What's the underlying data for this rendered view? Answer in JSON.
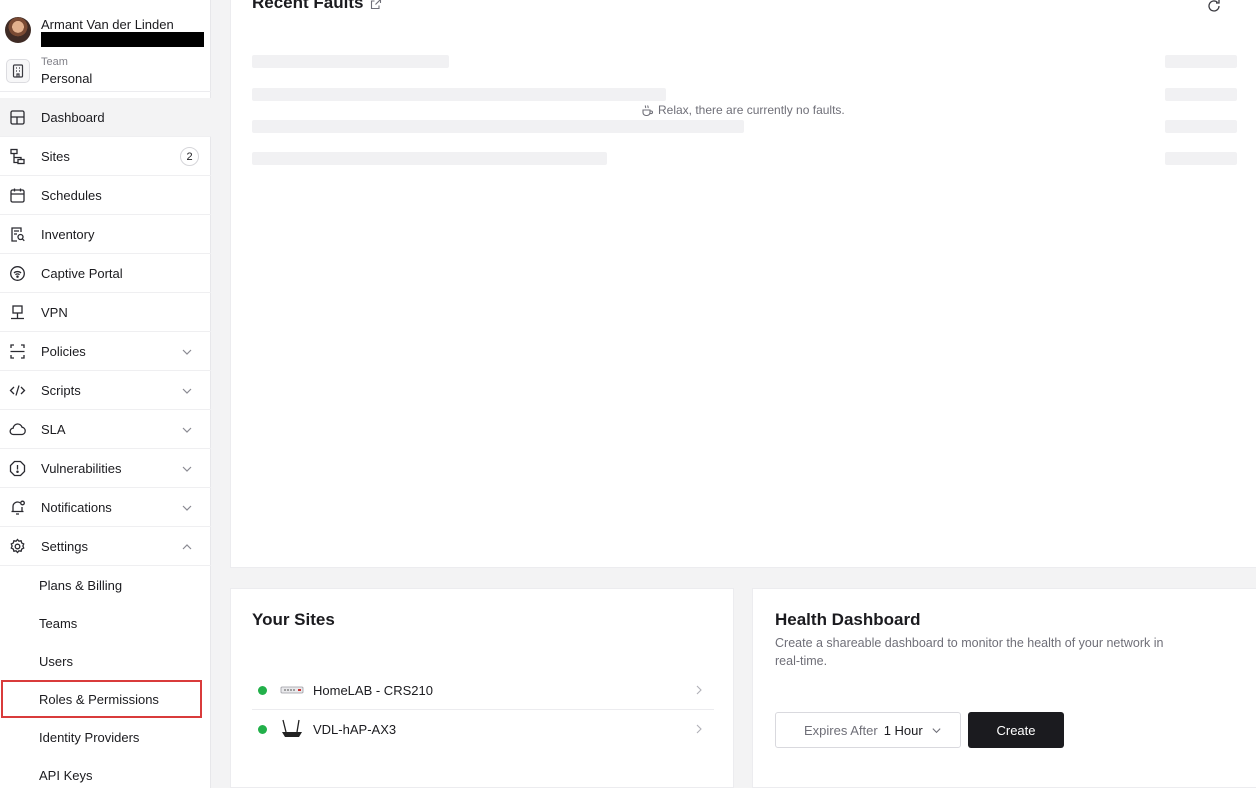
{
  "user": {
    "name": "Armant Van der Linden"
  },
  "team": {
    "label": "Team",
    "value": "Personal"
  },
  "nav": [
    {
      "label": "Dashboard",
      "icon": "dashboard-icon"
    },
    {
      "label": "Sites",
      "icon": "sites-icon",
      "badge": "2"
    },
    {
      "label": "Schedules",
      "icon": "calendar-icon"
    },
    {
      "label": "Inventory",
      "icon": "inventory-icon"
    },
    {
      "label": "Captive Portal",
      "icon": "wifi-portal-icon"
    },
    {
      "label": "VPN",
      "icon": "vpn-icon"
    },
    {
      "label": "Policies",
      "icon": "policies-icon"
    },
    {
      "label": "Scripts",
      "icon": "code-icon"
    },
    {
      "label": "SLA",
      "icon": "cloud-icon"
    },
    {
      "label": "Vulnerabilities",
      "icon": "alert-icon"
    },
    {
      "label": "Notifications",
      "icon": "bell-icon"
    },
    {
      "label": "Settings",
      "icon": "gear-icon"
    }
  ],
  "settings_sub": [
    {
      "label": "Plans & Billing"
    },
    {
      "label": "Teams"
    },
    {
      "label": "Users"
    },
    {
      "label": "Roles & Permissions"
    },
    {
      "label": "Identity Providers"
    },
    {
      "label": "API Keys"
    }
  ],
  "faults": {
    "title": "Recent Faults",
    "empty_message": "Relax, there are currently no faults."
  },
  "sites": {
    "title": "Your Sites",
    "items": [
      {
        "name": "HomeLAB - CRS210",
        "status_color": "#22b04a"
      },
      {
        "name": "VDL-hAP-AX3",
        "status_color": "#22b04a"
      }
    ]
  },
  "health": {
    "title": "Health Dashboard",
    "description": "Create a shareable dashboard to monitor the health of your network in real-time.",
    "expires_label": "Expires After",
    "expires_value": "1 Hour",
    "create_label": "Create"
  },
  "colors": {
    "status_green": "#22b04a",
    "highlight_red": "#d93b3b",
    "button_dark": "#1b1b1f"
  }
}
